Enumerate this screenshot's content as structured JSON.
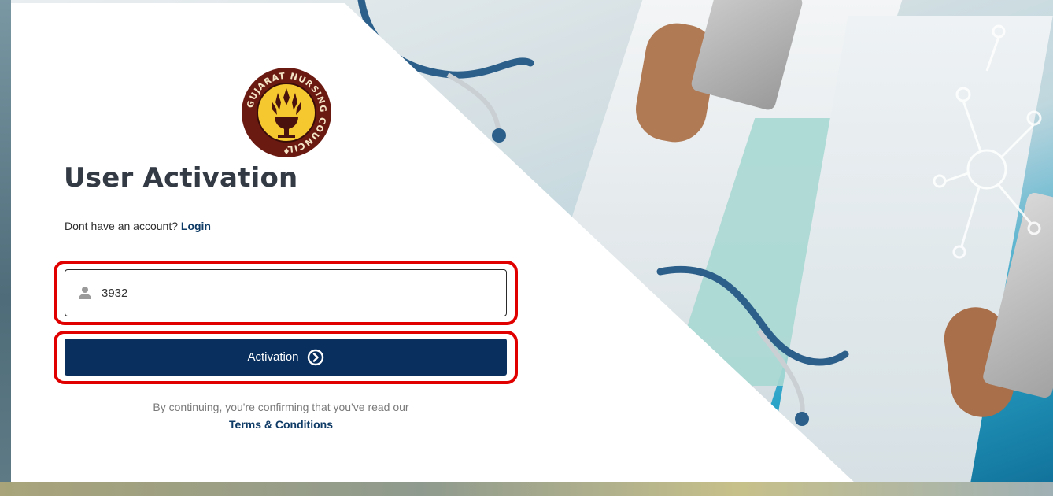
{
  "logo": {
    "org_name": "GUJARAT NURSING COUNCIL",
    "icon": "council-emblem-icon"
  },
  "form": {
    "title": "User Activation",
    "signup_prompt": "Dont have an account?",
    "login_link": "Login",
    "user_id_value": "3932",
    "user_icon": "user-icon",
    "activation_button": "Activation",
    "activation_icon": "chevron-right-circle-icon",
    "terms_note": "By continuing, you're confirming that you've read our",
    "terms_link": "Terms & Conditions"
  },
  "colors": {
    "primary": "#082f5e",
    "link": "#0e3a66",
    "highlight": "#e10000"
  }
}
